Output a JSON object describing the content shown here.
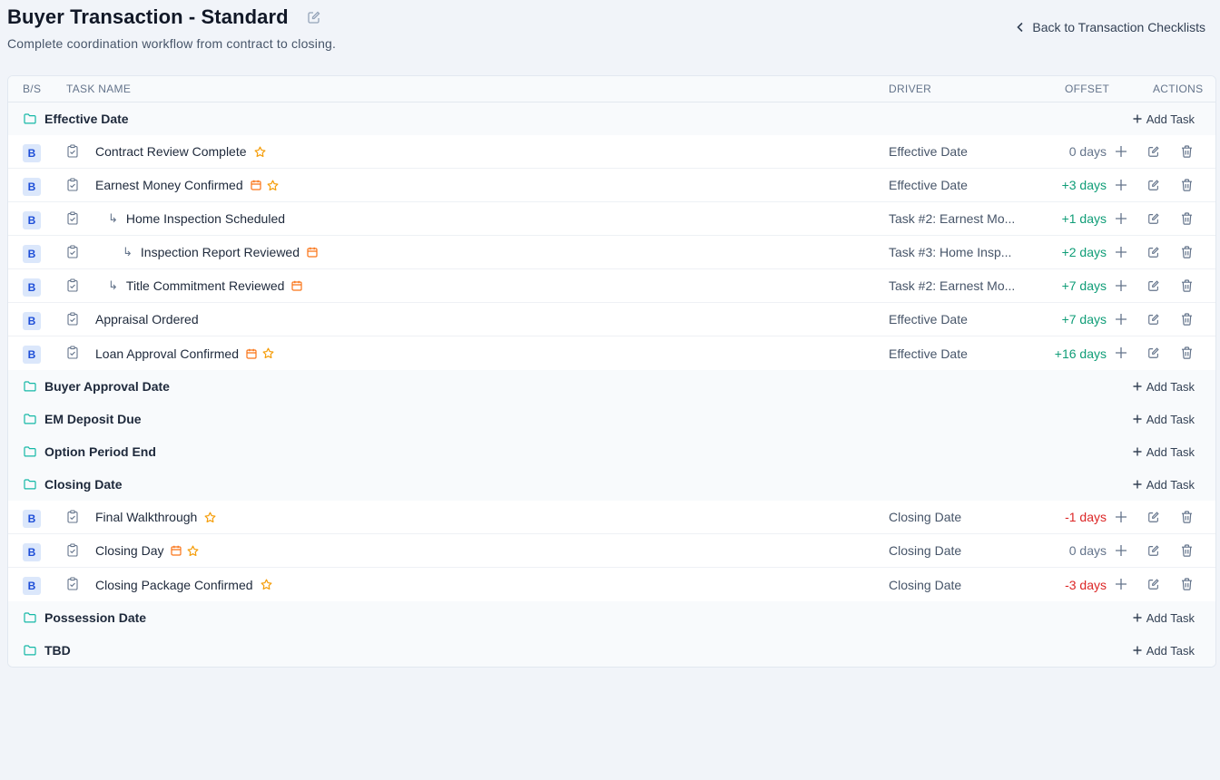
{
  "header": {
    "title": "Buyer Transaction - Standard",
    "subtitle": "Complete coordination workflow from contract to closing.",
    "back_label": "Back to Transaction Checklists"
  },
  "table": {
    "columns": {
      "bs": "B/S",
      "task_name": "TASK NAME",
      "driver": "DRIVER",
      "offset": "OFFSET",
      "actions": "ACTIONS"
    },
    "add_task_label": "Add Task",
    "groups": [
      {
        "name": "Effective Date",
        "tasks": [
          {
            "side": "B",
            "name": "Contract Review Complete",
            "indent": 0,
            "calendar": false,
            "star": true,
            "driver": "Effective Date",
            "offset": "0 days",
            "offset_kind": "zero"
          },
          {
            "side": "B",
            "name": "Earnest Money Confirmed",
            "indent": 0,
            "calendar": true,
            "star": true,
            "driver": "Effective Date",
            "offset": "+3 days",
            "offset_kind": "pos"
          },
          {
            "side": "B",
            "name": "Home Inspection Scheduled",
            "indent": 1,
            "calendar": false,
            "star": false,
            "driver": "Task #2: Earnest Mo...",
            "offset": "+1 days",
            "offset_kind": "pos"
          },
          {
            "side": "B",
            "name": "Inspection Report Reviewed",
            "indent": 2,
            "calendar": true,
            "star": false,
            "driver": "Task #3: Home Insp...",
            "offset": "+2 days",
            "offset_kind": "pos"
          },
          {
            "side": "B",
            "name": "Title Commitment Reviewed",
            "indent": 1,
            "calendar": true,
            "star": false,
            "driver": "Task #2: Earnest Mo...",
            "offset": "+7 days",
            "offset_kind": "pos"
          },
          {
            "side": "B",
            "name": "Appraisal Ordered",
            "indent": 0,
            "calendar": false,
            "star": false,
            "driver": "Effective Date",
            "offset": "+7 days",
            "offset_kind": "pos"
          },
          {
            "side": "B",
            "name": "Loan Approval Confirmed",
            "indent": 0,
            "calendar": true,
            "star": true,
            "driver": "Effective Date",
            "offset": "+16 days",
            "offset_kind": "pos"
          }
        ]
      },
      {
        "name": "Buyer Approval Date",
        "tasks": []
      },
      {
        "name": "EM Deposit Due",
        "tasks": []
      },
      {
        "name": "Option Period End",
        "tasks": []
      },
      {
        "name": "Closing Date",
        "tasks": [
          {
            "side": "B",
            "name": "Final Walkthrough",
            "indent": 0,
            "calendar": false,
            "star": true,
            "driver": "Closing Date",
            "offset": "-1 days",
            "offset_kind": "neg"
          },
          {
            "side": "B",
            "name": "Closing Day",
            "indent": 0,
            "calendar": true,
            "star": true,
            "driver": "Closing Date",
            "offset": "0 days",
            "offset_kind": "zero"
          },
          {
            "side": "B",
            "name": "Closing Package Confirmed",
            "indent": 0,
            "calendar": false,
            "star": true,
            "driver": "Closing Date",
            "offset": "-3 days",
            "offset_kind": "neg"
          }
        ]
      },
      {
        "name": "Possession Date",
        "tasks": []
      },
      {
        "name": "TBD",
        "tasks": []
      }
    ]
  },
  "colors": {
    "accent_teal": "#14b8a6",
    "positive": "#0f9d77",
    "negative": "#dc2626",
    "marker_orange": "#f59e0b",
    "calendar_orange": "#f97316",
    "badge_blue": "#1d4ed8"
  },
  "icons": [
    "edit-icon",
    "chevron-left-icon",
    "folder-icon",
    "plus-icon",
    "clipboard-icon",
    "star-icon",
    "calendar-icon",
    "trash-icon",
    "subtask-arrow-icon"
  ]
}
